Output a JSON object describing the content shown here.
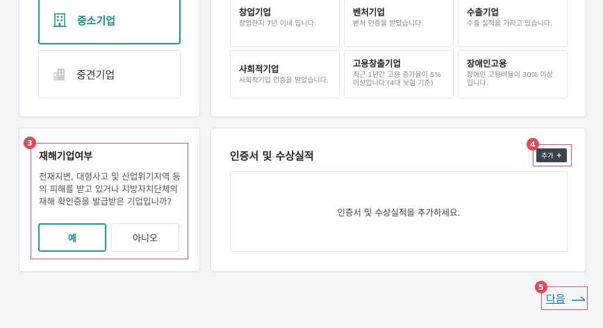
{
  "size_options": [
    {
      "label": "중소기업",
      "selected": true
    },
    {
      "label": "중견기업",
      "selected": false
    }
  ],
  "company_types": [
    {
      "title": "창업기업",
      "desc": "창업한지 7년 이내 입니다."
    },
    {
      "title": "벤처기업",
      "desc": "벤처 인증을 받았습니다."
    },
    {
      "title": "수출기업",
      "desc": "수출 실적을 가지고 있습니다."
    },
    {
      "title": "사회적기업",
      "desc": "사회적기업 인증을 받았습니다."
    },
    {
      "title": "고용창출기업",
      "desc": "최근 1년간 고용 증가율이 5% 이상입니다.(4대 보험 기준)"
    },
    {
      "title": "장애인고용",
      "desc": "장애인 고용비율이 30% 이상입니다."
    }
  ],
  "disaster": {
    "title": "재해기업여부",
    "question": "천재지변, 대형사고 및 산업위기지역 등의 피해를 받고 있거나 지방자치단체의 재해 확인증을 발급받은 기업입니까?",
    "yes_label": "예",
    "no_label": "아니오",
    "selected": "yes"
  },
  "certs": {
    "title": "인증서 및 수상실적",
    "add_label": "추가",
    "add_icon": "plus-icon",
    "empty_text": "인증서 및 수상실적을 추가하세요."
  },
  "badges": {
    "disaster": "3",
    "add": "4",
    "next": "5"
  },
  "next_label": "다음",
  "colors": {
    "accent": "#1a9a9a",
    "badge": "#e5485a",
    "link": "#1a77c9",
    "add_button": "#3c4451"
  }
}
